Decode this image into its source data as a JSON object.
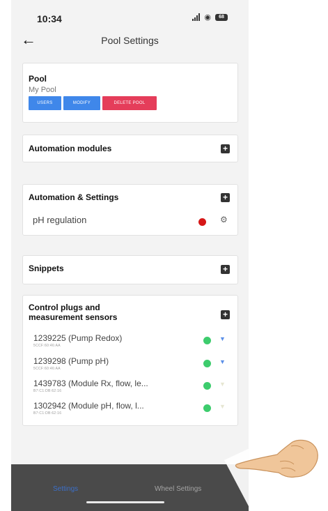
{
  "status_bar": {
    "time": "10:34",
    "battery": "68"
  },
  "header": {
    "title": "Pool Settings"
  },
  "pool_card": {
    "title": "Pool",
    "name": "My Pool",
    "buttons": [
      "USERS",
      "MODIFY",
      "DELETE POOL"
    ]
  },
  "automation_modules": {
    "title": "Automation modules"
  },
  "automation_settings": {
    "title": "Automation & Settings",
    "items": [
      {
        "label": "pH regulation",
        "status": "red"
      }
    ]
  },
  "snippets": {
    "title": "Snippets"
  },
  "control_plugs": {
    "title_line1": "Control plugs and",
    "title_line2": "measurement sensors",
    "items": [
      {
        "label": "1239225 (Pump Redox)",
        "sub": "5CCF:60:46:AA",
        "status": "green"
      },
      {
        "label": "1239298 (Pump pH)",
        "sub": "5CCF:60:46:AA",
        "status": "green"
      },
      {
        "label": "1439783 (Module Rx, flow, le...",
        "sub": "B7:C1:DB:62:16",
        "status": "green"
      },
      {
        "label": "1302942 (Module pH, flow, l...",
        "sub": "B7:C1:DB:62:16",
        "status": "green"
      }
    ]
  },
  "tab_bar": {
    "settings": "Settings",
    "wheel_settings": "Wheel Settings"
  },
  "colors": {
    "blue_button": "#3f87ea",
    "red_button": "#e53d5a",
    "status_red": "#d61818",
    "status_green": "#3dcc6d",
    "tab_active": "#3c6fc8"
  }
}
